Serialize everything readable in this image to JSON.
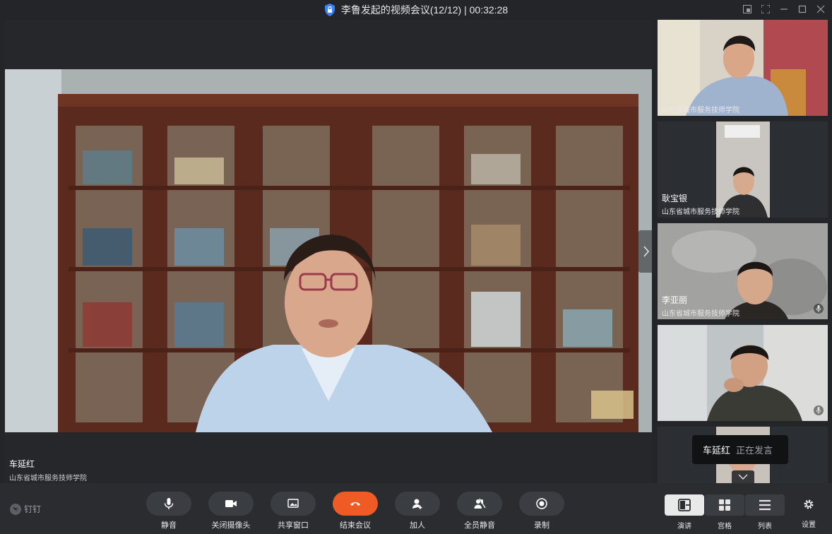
{
  "window": {
    "title": "李鲁发起的视频会议(12/12) | 00:32:28"
  },
  "main": {
    "speaker_name": "车延红",
    "speaker_org": "山东省城市服务技师学院"
  },
  "side": {
    "tiles": [
      {
        "name": "",
        "org": "山东省城市服务技师学院"
      },
      {
        "name": "耿宝银",
        "org": "山东省城市服务技师学院"
      },
      {
        "name": "李亚丽",
        "org": "山东省城市服务技师学院"
      },
      {
        "name": "",
        "org": ""
      },
      {
        "name": "",
        "org": ""
      }
    ]
  },
  "toast": {
    "name": "车延红",
    "status": "正在发言"
  },
  "brand": {
    "label": "钉钉"
  },
  "toolbar": {
    "mute": "静音",
    "camera_off": "关闭摄像头",
    "share_window": "共享窗口",
    "end_meeting": "结束会议",
    "add_person": "加人",
    "mute_all": "全员静音",
    "record": "录制"
  },
  "views": {
    "speaker": "演讲",
    "grid": "宫格",
    "list": "列表",
    "settings": "设置"
  },
  "colors": {
    "end_button": "#f05a24",
    "accent_blue": "#3b82f6",
    "background": "#232529"
  }
}
